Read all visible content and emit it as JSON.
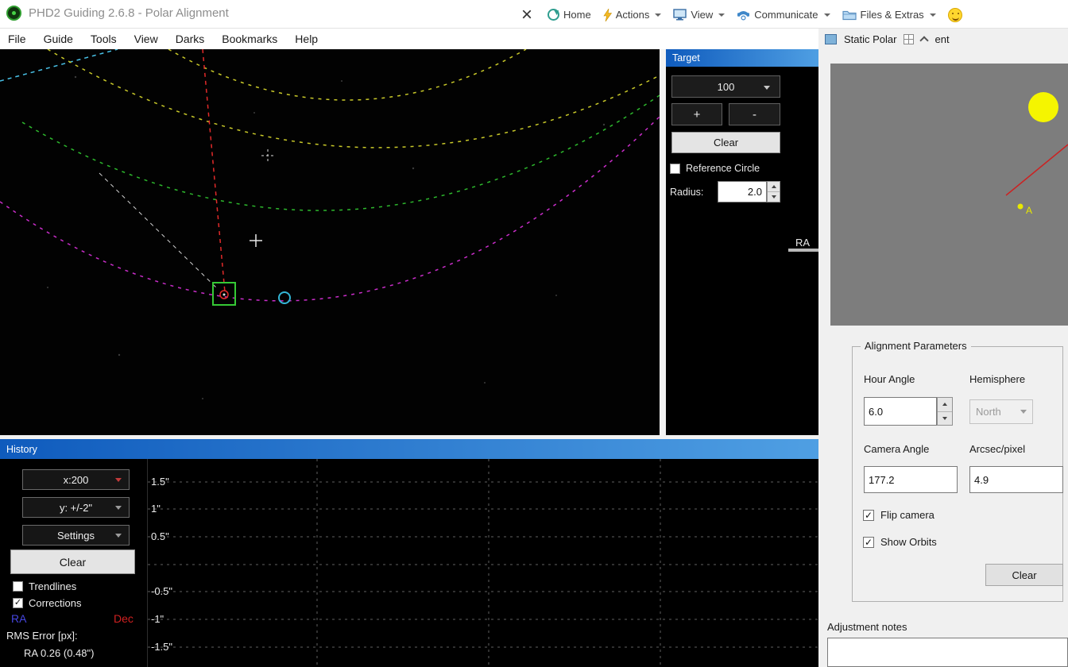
{
  "titlebar": {
    "title": "PHD2 Guiding 2.6.8 - Polar Alignment",
    "toolbar": {
      "home": "Home",
      "actions": "Actions",
      "view": "View",
      "communicate": "Communicate",
      "files_extras": "Files & Extras"
    }
  },
  "icons": {
    "close": "×",
    "check": "✓"
  },
  "menubar": {
    "items": [
      "File",
      "Guide",
      "Tools",
      "View",
      "Darks",
      "Bookmarks",
      "Help"
    ]
  },
  "target_panel": {
    "title": "Target",
    "zoom_value": "100",
    "plus_label": "+",
    "minus_label": "-",
    "clear_label": "Clear",
    "reference_circle_label": "Reference Circle",
    "radius_label": "Radius:",
    "radius_value": "2.0",
    "ra_label": "RA"
  },
  "polar_panel": {
    "title_prefix": "Static Polar",
    "title_suffix": "ent",
    "star_label": "A",
    "params": {
      "legend": "Alignment Parameters",
      "hour_angle_label": "Hour Angle",
      "hour_angle_value": "6.0",
      "hemisphere_label": "Hemisphere",
      "hemisphere_value": "North",
      "camera_angle_label": "Camera Angle",
      "camera_angle_value": "177.2",
      "arcsec_label": "Arcsec/pixel",
      "arcsec_value": "4.9",
      "flip_camera_label": "Flip camera",
      "show_orbits_label": "Show Orbits",
      "clear_label": "Clear"
    },
    "notes_label": "Adjustment notes",
    "notes_value": ""
  },
  "history_panel": {
    "title": "History",
    "x_scale_label": "x:200",
    "y_scale_label": "y: +/-2\"",
    "settings_label": "Settings",
    "clear_label": "Clear",
    "trendlines_label": "Trendlines",
    "corrections_label": "Corrections",
    "ra_series_label": "RA",
    "dec_series_label": "Dec",
    "rms_label": "RMS Error [px]:",
    "rms_ra_value": "RA  0.26 (0.48\")",
    "y_ticks": [
      "1.5\"",
      "1\"",
      "0.5\"",
      "-0.5\"",
      "-1\"",
      "-1.5\""
    ]
  },
  "colors": {
    "caption_start": "#0f5bbd",
    "caption_end": "#4f9fe3",
    "ra_color": "#4646e0",
    "dec_color": "#d02020",
    "orbit_yellow": "#c9c929",
    "orbit_green": "#2db82d",
    "orbit_magenta": "#c92dc9"
  }
}
